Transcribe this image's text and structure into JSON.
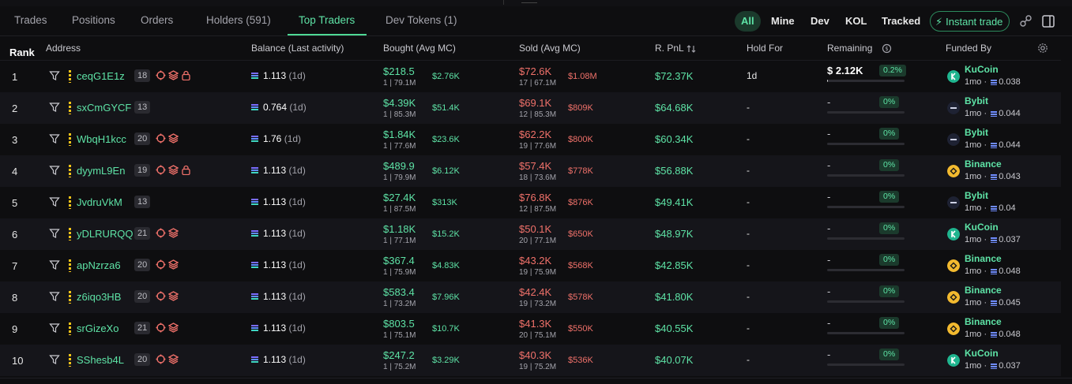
{
  "tabs": [
    {
      "label": "Trades"
    },
    {
      "label": "Positions"
    },
    {
      "label": "Orders"
    },
    {
      "label": "Holders (591)"
    },
    {
      "label": "Top Traders"
    },
    {
      "label": "Dev Tokens (1)"
    }
  ],
  "active_tab": "Top Traders",
  "filters": {
    "all": "All",
    "mine": "Mine",
    "dev": "Dev",
    "kol": "KOL",
    "tracked": "Tracked",
    "instant_trade": "Instant trade"
  },
  "columns": {
    "rank": "Rank",
    "address": "Address",
    "balance": "Balance (Last activity)",
    "bought": "Bought (Avg MC)",
    "sold": "Sold (Avg MC)",
    "pnl": "R. PnL",
    "hold": "Hold For",
    "remaining": "Remaining",
    "funded": "Funded By"
  },
  "colors": {
    "accent_green": "#5ee3a6",
    "loss_red": "#f0716a",
    "kucoin": "#1fb58f",
    "binance": "#f3ba2f",
    "bybit": "#1e2233"
  },
  "rows": [
    {
      "rank": "1",
      "address": "ceqG1E1z",
      "badge": "18",
      "icons": [
        "crosshair-icon",
        "stack-icon",
        "lock-icon"
      ],
      "balance": "1.113",
      "activity": "(1d)",
      "bought": "$218.5",
      "bought_sub": "1 | 79.1M",
      "bought_mc": "$2.76K",
      "sold": "$72.6K",
      "sold_sub": "17 | 67.1M",
      "sold_mc": "$1.08M",
      "pnl": "$72.37K",
      "hold": "1d",
      "remaining": "$ 2.12K",
      "remaining_pct": "0.2%",
      "remaining_fill": 0.002,
      "funder": "KuCoin",
      "funder_icon": "kucoin-icon",
      "funded_time": "1mo",
      "funded_amt": "0.038"
    },
    {
      "rank": "2",
      "address": "sxCmGYCF",
      "badge": "13",
      "icons": [],
      "balance": "0.764",
      "activity": "(1d)",
      "bought": "$4.39K",
      "bought_sub": "1 | 85.3M",
      "bought_mc": "$51.4K",
      "sold": "$69.1K",
      "sold_sub": "12 | 85.3M",
      "sold_mc": "$809K",
      "pnl": "$64.68K",
      "hold": "-",
      "remaining": "-",
      "remaining_pct": "0%",
      "remaining_fill": 0,
      "funder": "Bybit",
      "funder_icon": "bybit-icon",
      "funded_time": "1mo",
      "funded_amt": "0.044"
    },
    {
      "rank": "3",
      "address": "WbqH1kcc",
      "badge": "20",
      "icons": [
        "crosshair-icon",
        "stack-icon"
      ],
      "balance": "1.76",
      "activity": "(1d)",
      "bought": "$1.84K",
      "bought_sub": "1 | 77.6M",
      "bought_mc": "$23.6K",
      "sold": "$62.2K",
      "sold_sub": "19 | 77.6M",
      "sold_mc": "$800K",
      "pnl": "$60.34K",
      "hold": "-",
      "remaining": "-",
      "remaining_pct": "0%",
      "remaining_fill": 0,
      "funder": "Bybit",
      "funder_icon": "bybit-icon",
      "funded_time": "1mo",
      "funded_amt": "0.044"
    },
    {
      "rank": "4",
      "address": "dyymL9En",
      "badge": "19",
      "icons": [
        "crosshair-icon",
        "stack-icon",
        "lock-icon"
      ],
      "balance": "1.113",
      "activity": "(1d)",
      "bought": "$489.9",
      "bought_sub": "1 | 79.9M",
      "bought_mc": "$6.12K",
      "sold": "$57.4K",
      "sold_sub": "18 | 73.6M",
      "sold_mc": "$778K",
      "pnl": "$56.88K",
      "hold": "-",
      "remaining": "-",
      "remaining_pct": "0%",
      "remaining_fill": 0,
      "funder": "Binance",
      "funder_icon": "binance-icon",
      "funded_time": "1mo",
      "funded_amt": "0.043"
    },
    {
      "rank": "5",
      "address": "JvdruVkM",
      "badge": "13",
      "icons": [],
      "balance": "1.113",
      "activity": "(1d)",
      "bought": "$27.4K",
      "bought_sub": "1 | 87.5M",
      "bought_mc": "$313K",
      "sold": "$76.8K",
      "sold_sub": "12 | 87.5M",
      "sold_mc": "$876K",
      "pnl": "$49.41K",
      "hold": "-",
      "remaining": "-",
      "remaining_pct": "0%",
      "remaining_fill": 0,
      "funder": "Bybit",
      "funder_icon": "bybit-icon",
      "funded_time": "1mo",
      "funded_amt": "0.04"
    },
    {
      "rank": "6",
      "address": "yDLRURQQ",
      "badge": "21",
      "icons": [
        "crosshair-icon",
        "stack-icon"
      ],
      "balance": "1.113",
      "activity": "(1d)",
      "bought": "$1.18K",
      "bought_sub": "1 | 77.1M",
      "bought_mc": "$15.2K",
      "sold": "$50.1K",
      "sold_sub": "20 | 77.1M",
      "sold_mc": "$650K",
      "pnl": "$48.97K",
      "hold": "-",
      "remaining": "-",
      "remaining_pct": "0%",
      "remaining_fill": 0,
      "funder": "KuCoin",
      "funder_icon": "kucoin-icon",
      "funded_time": "1mo",
      "funded_amt": "0.037"
    },
    {
      "rank": "7",
      "address": "apNzrza6",
      "badge": "20",
      "icons": [
        "crosshair-icon",
        "stack-icon"
      ],
      "balance": "1.113",
      "activity": "(1d)",
      "bought": "$367.4",
      "bought_sub": "1 | 75.9M",
      "bought_mc": "$4.83K",
      "sold": "$43.2K",
      "sold_sub": "19 | 75.9M",
      "sold_mc": "$568K",
      "pnl": "$42.85K",
      "hold": "-",
      "remaining": "-",
      "remaining_pct": "0%",
      "remaining_fill": 0,
      "funder": "Binance",
      "funder_icon": "binance-icon",
      "funded_time": "1mo",
      "funded_amt": "0.048"
    },
    {
      "rank": "8",
      "address": "z6iqo3HB",
      "badge": "20",
      "icons": [
        "crosshair-icon",
        "stack-icon"
      ],
      "balance": "1.113",
      "activity": "(1d)",
      "bought": "$583.4",
      "bought_sub": "1 | 73.2M",
      "bought_mc": "$7.96K",
      "sold": "$42.4K",
      "sold_sub": "19 | 73.2M",
      "sold_mc": "$578K",
      "pnl": "$41.80K",
      "hold": "-",
      "remaining": "-",
      "remaining_pct": "0%",
      "remaining_fill": 0,
      "funder": "Binance",
      "funder_icon": "binance-icon",
      "funded_time": "1mo",
      "funded_amt": "0.045"
    },
    {
      "rank": "9",
      "address": "srGizeXo",
      "badge": "21",
      "icons": [
        "crosshair-icon",
        "stack-icon"
      ],
      "balance": "1.113",
      "activity": "(1d)",
      "bought": "$803.5",
      "bought_sub": "1 | 75.1M",
      "bought_mc": "$10.7K",
      "sold": "$41.3K",
      "sold_sub": "20 | 75.1M",
      "sold_mc": "$550K",
      "pnl": "$40.55K",
      "hold": "-",
      "remaining": "-",
      "remaining_pct": "0%",
      "remaining_fill": 0,
      "funder": "Binance",
      "funder_icon": "binance-icon",
      "funded_time": "1mo",
      "funded_amt": "0.048"
    },
    {
      "rank": "10",
      "address": "SShesb4L",
      "badge": "20",
      "icons": [
        "crosshair-icon",
        "stack-icon"
      ],
      "balance": "1.113",
      "activity": "(1d)",
      "bought": "$247.2",
      "bought_sub": "1 | 75.2M",
      "bought_mc": "$3.29K",
      "sold": "$40.3K",
      "sold_sub": "19 | 75.2M",
      "sold_mc": "$536K",
      "pnl": "$40.07K",
      "hold": "-",
      "remaining": "-",
      "remaining_pct": "0%",
      "remaining_fill": 0,
      "funder": "KuCoin",
      "funder_icon": "kucoin-icon",
      "funded_time": "1mo",
      "funded_amt": "0.037"
    }
  ]
}
